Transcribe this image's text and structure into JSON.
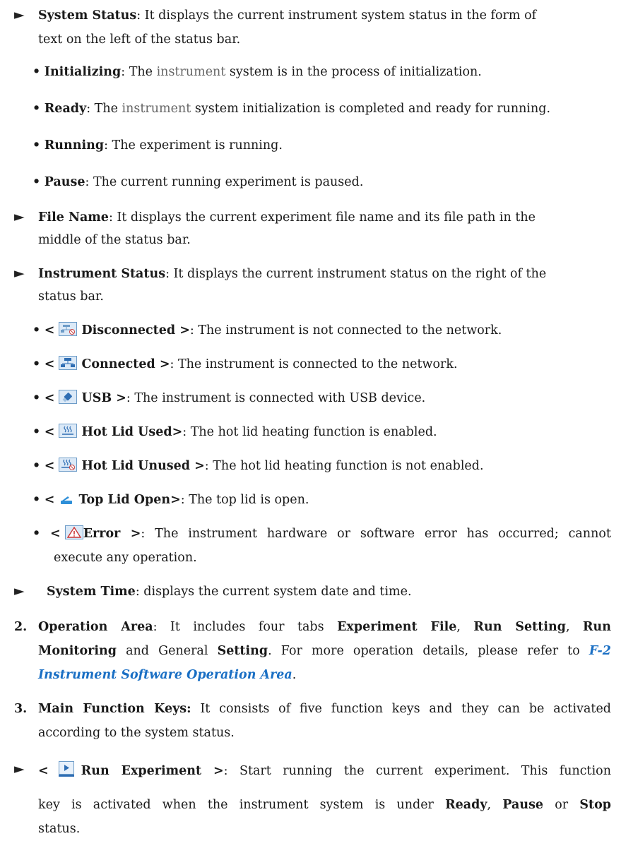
{
  "system_status": {
    "title": "System Status",
    "line1_rest": ": It displays the current instrument system status in the form of",
    "line2": "text on the left of the status bar.",
    "items": [
      {
        "label": "Initializing",
        "p1": ": The ",
        "gray": "instrument",
        "p2": " system is in the process of initialization."
      },
      {
        "label": "Ready",
        "p1": ": The ",
        "gray": "instrument",
        "p2": " system initialization is completed and ready for running."
      },
      {
        "label": "Running",
        "p1": ": The experiment is running.",
        "gray": "",
        "p2": ""
      },
      {
        "label": "Pause",
        "p1": ": The current running experiment is paused.",
        "gray": "",
        "p2": ""
      }
    ]
  },
  "file_name": {
    "title": "File Name",
    "line1_rest": ": It displays the current experiment file name and its file path in the",
    "line2": "middle of the status bar."
  },
  "instrument_status": {
    "title": "Instrument Status",
    "line1_rest": ": It displays the current instrument status on the right of the",
    "line2": "status bar.",
    "items": [
      {
        "icon": "network-disconnected-icon",
        "label": "Disconnected >",
        "text": ": The instrument is not connected to the network."
      },
      {
        "icon": "network-connected-icon",
        "label": "Connected >",
        "text": ": The instrument is connected to the network."
      },
      {
        "icon": "usb-icon",
        "label": "USB >",
        "text": ": The instrument is connected with USB device."
      },
      {
        "icon": "hot-lid-used-icon",
        "label": "Hot Lid Used>",
        "text": ": The hot lid heating function is enabled."
      },
      {
        "icon": "hot-lid-unused-icon",
        "label": "Hot Lid Unused >",
        "text": ": The hot lid heating function is not enabled."
      },
      {
        "icon": "top-lid-open-icon",
        "label": "Top Lid Open>",
        "text": ": The top lid is open."
      },
      {
        "icon": "error-warning-icon",
        "label": "Error >",
        "text": ": The instrument hardware or software error has occurred; cannot",
        "text2": "execute any operation."
      }
    ]
  },
  "system_time": {
    "title": "System Time",
    "rest": ": displays the current system date and time."
  },
  "operation_area": {
    "number": "2.",
    "title": "Operation Area",
    "t1": ": It includes four tabs ",
    "tab1": "Experiment File",
    "sep1": ", ",
    "tab2": "Run Setting",
    "sep2": ", ",
    "tab3a": "Run",
    "tab3b": "Monitoring",
    "t2": " and General ",
    "tab4": "Setting",
    "t3": ". For more operation details, please refer to ",
    "link1": "F-2",
    "link2": "Instrument Software Operation Area",
    "t4": "."
  },
  "main_keys": {
    "number": "3.",
    "title": "Main Function Keys:",
    "line1_rest": " It consists of five function keys and they can be activated",
    "line2": "according to the system status."
  },
  "run_experiment": {
    "lt": "<",
    "label": "Run Experiment >",
    "line1_rest": ": Start running the current experiment. This function",
    "line2a": "key is activated when the instrument system is under ",
    "ready": "Ready",
    "comma": ", ",
    "pause": "Pause",
    "or": " or ",
    "stop": "Stop",
    "line3": "status."
  },
  "glyphs": {
    "triangle": "►",
    "bullet": "•",
    "lt": "<"
  }
}
